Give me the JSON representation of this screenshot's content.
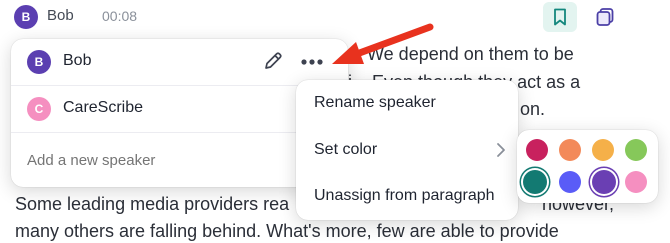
{
  "header": {
    "speaker_name": "Bob",
    "avatar_letter": "B",
    "timestamp": "00:08"
  },
  "transcript": {
    "line1": "s. We depend on them to be",
    "line2": "i... Even though they act as a",
    "line3": "on.",
    "line4": "Some leading media providers rea",
    "line4_right": "however,",
    "line5": "many others are falling behind. What's more, few are able to provide"
  },
  "speaker_panel": {
    "speakers": [
      {
        "letter": "B",
        "name": "Bob",
        "color": "#5b3fb1"
      },
      {
        "letter": "C",
        "name": "CareScribe",
        "color": "#f58fc0"
      }
    ],
    "add_placeholder": "Add a new speaker"
  },
  "context_menu": {
    "rename": "Rename speaker",
    "set_color": "Set color",
    "unassign": "Unassign from paragraph"
  },
  "color_palette": {
    "row1": [
      "#c8215e",
      "#f38a5a",
      "#f5b049",
      "#86c85a"
    ],
    "row2": [
      "#137a72",
      "#5a5cf7",
      "#6a3fb3",
      "#f58fc0"
    ],
    "selected": "#6a3fb3"
  },
  "annotation_color": "#e8321e"
}
